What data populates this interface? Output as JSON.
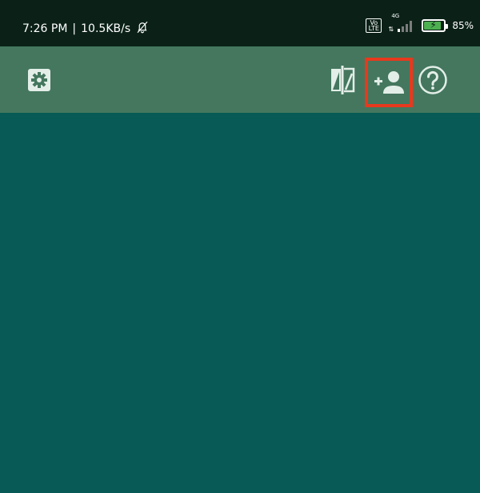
{
  "status_bar": {
    "time": "7:26 PM",
    "separator": "|",
    "network_speed": "10.5KB/s",
    "volte_label": "Vo\nLTE",
    "network_type": "4G",
    "battery_percent": "85%",
    "battery_level": 0.85,
    "icons": [
      "alarm-off-icon",
      "signal-icon",
      "battery-charging-icon"
    ]
  },
  "toolbar": {
    "background": "#44775e",
    "icon_color": "#e3eee8",
    "highlight_color": "#e8391d",
    "buttons": [
      {
        "icon": "settings-gear-icon"
      },
      {
        "icon": "swap-view-icon"
      },
      {
        "icon": "add-user-icon",
        "highlighted": true
      },
      {
        "icon": "help-icon"
      }
    ]
  },
  "content": {
    "background": "#075a55"
  }
}
